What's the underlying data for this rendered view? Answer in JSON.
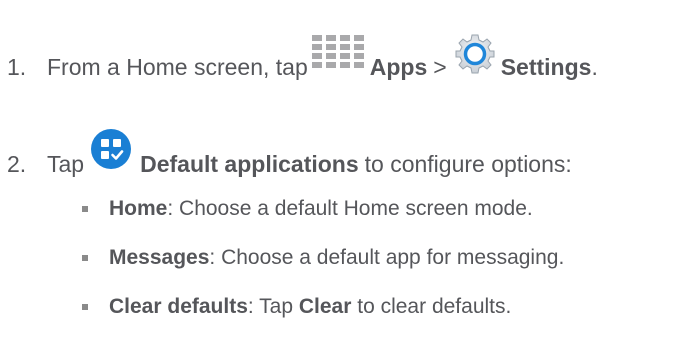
{
  "steps": [
    {
      "number": "1.",
      "text_before": "From a Home screen, tap",
      "apps_icon": "apps-grid-icon",
      "apps_label": "Apps",
      "separator": ">",
      "settings_icon": "gear-icon",
      "settings_label": "Settings",
      "end": "."
    },
    {
      "number": "2.",
      "text_before": "Tap",
      "defaults_icon": "default-applications-icon",
      "defaults_label": "Default applications",
      "text_after": "to configure options:"
    }
  ],
  "bullets": [
    {
      "term": "Home",
      "desc": ": Choose a default Home screen mode."
    },
    {
      "term": "Messages",
      "desc": ": Choose a default app for messaging."
    },
    {
      "term": "Clear defaults",
      "desc_before": ": Tap ",
      "action": "Clear",
      "desc_after": " to clear defaults."
    }
  ],
  "colors": {
    "text": "#55565a",
    "apps_icon": "#a9a9ab",
    "settings_icon_blue": "#1f86d9",
    "defaults_icon_blue": "#1a7fd4",
    "bullet": "#8a8a8a"
  }
}
